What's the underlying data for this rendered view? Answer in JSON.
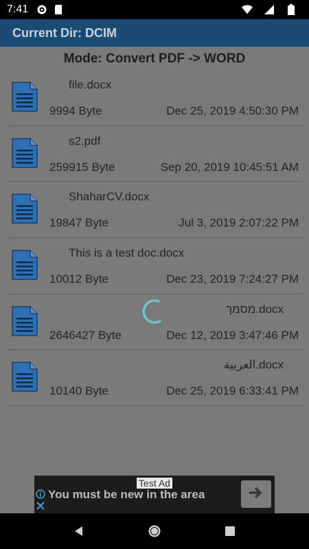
{
  "status_bar": {
    "time": "7:41"
  },
  "appbar": {
    "title": "Current Dir: DCIM"
  },
  "mode": {
    "text": "Mode: Convert PDF -> WORD"
  },
  "files": [
    {
      "name": "file.docx",
      "size": "9994 Byte",
      "date": "Dec 25, 2019 4:50:30 PM"
    },
    {
      "name": "s2.pdf",
      "size": "259915 Byte",
      "date": "Sep 20, 2019 10:45:51 AM"
    },
    {
      "name": "ShaharCV.docx",
      "size": "19847 Byte",
      "date": "Jul 3, 2019 2:07:22 PM"
    },
    {
      "name": "This is a test doc.docx",
      "size": "10012 Byte",
      "date": "Dec 23, 2019 7:24:27 PM"
    },
    {
      "name": "מסמך.docx",
      "size": "2646427 Byte",
      "date": "Dec 12, 2019 3:47:46 PM"
    },
    {
      "name": "العربية.docx",
      "size": "10140 Byte",
      "date": "Dec 25, 2019 6:33:41 PM"
    }
  ],
  "ad": {
    "label": "Test Ad",
    "text": "You must be new in the area"
  },
  "icons": {
    "file": "document-icon",
    "spinner": "loading-spinner",
    "ad_action": "arrow-right-icon"
  },
  "colors": {
    "appbar": "#1b4a73",
    "doc_icon": "#2f6fb3",
    "spinner": "#6ec6c9"
  }
}
